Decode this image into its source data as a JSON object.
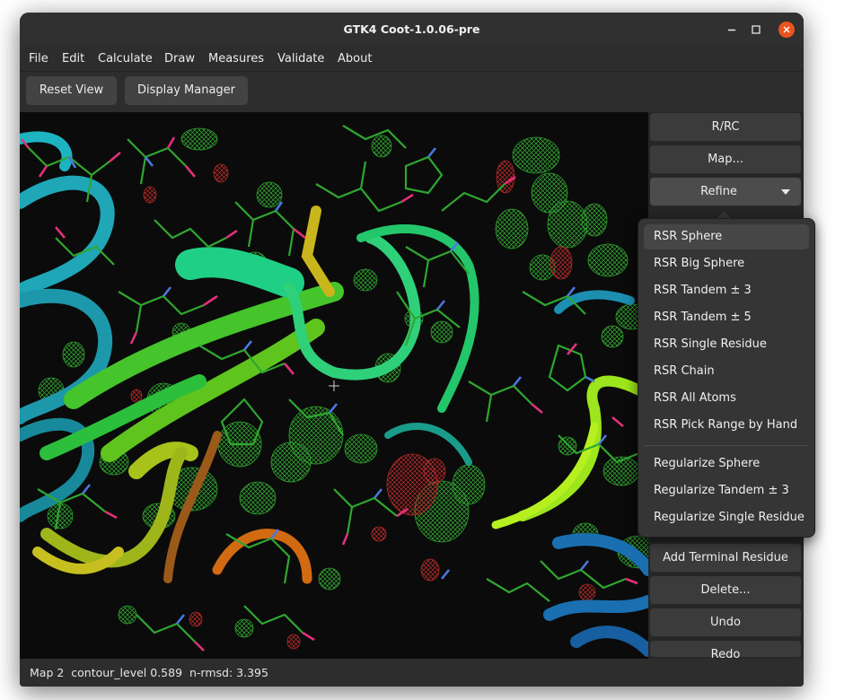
{
  "window": {
    "title": "GTK4 Coot-1.0.06-pre"
  },
  "menubar": {
    "items": [
      "File",
      "Edit",
      "Calculate",
      "Draw",
      "Measures",
      "Validate",
      "About"
    ]
  },
  "toolbar": {
    "reset_view": "Reset View",
    "display_manager": "Display Manager"
  },
  "sidebar": {
    "rrc": "R/RC",
    "map": "Map...",
    "refine": "Refine",
    "add_terminal_residue": "Add Terminal Residue",
    "delete": "Delete...",
    "undo": "Undo",
    "redo": "Redo"
  },
  "refine_menu": {
    "items": [
      "RSR Sphere",
      "RSR Big Sphere",
      "RSR Tandem ± 3",
      "RSR Tandem ± 5",
      "RSR Single Residue",
      "RSR Chain",
      "RSR All Atoms",
      "RSR Pick Range by Hand"
    ],
    "regularize_items": [
      "Regularize Sphere",
      "Regularize Tandem ± 3",
      "Regularize Single Residue"
    ]
  },
  "statusbar": {
    "text": "Map 2  contour_level 0.589  n-rmsd: 3.395"
  },
  "colors": {
    "window_bg": "#2d2d2d",
    "close_button": "#e95420",
    "density_positive": "#3fbf3f",
    "density_negative": "#c53030",
    "carbon_bonds": "#2fa72f",
    "oxygen": "#e0307a",
    "nitrogen": "#4a78e0"
  },
  "icons": [
    "minimize-icon",
    "maximize-icon",
    "close-icon",
    "chevron-down-icon",
    "crosshair-icon"
  ]
}
